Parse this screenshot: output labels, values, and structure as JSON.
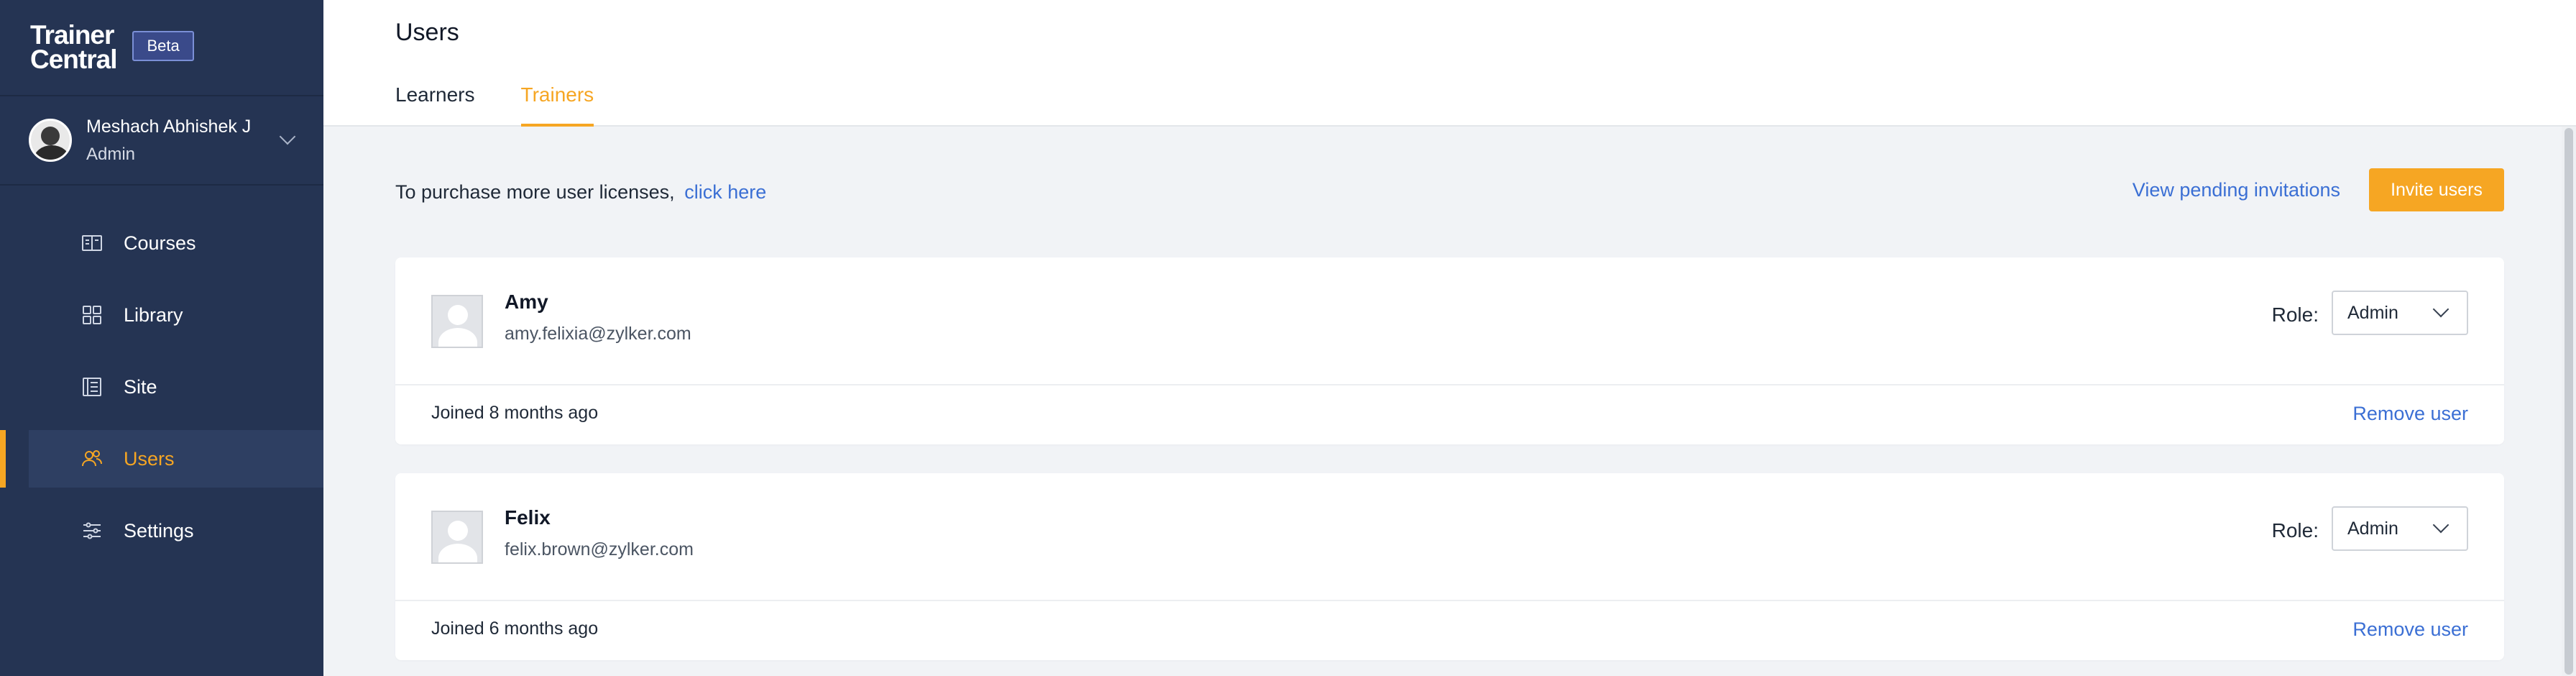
{
  "brand": {
    "logo_line1": "Trainer",
    "logo_line2": "Central",
    "badge": "Beta"
  },
  "profile": {
    "name": "Meshach Abhishek J",
    "role": "Admin"
  },
  "sidebar": {
    "items": [
      {
        "label": "Courses",
        "icon": "courses-icon"
      },
      {
        "label": "Library",
        "icon": "library-icon"
      },
      {
        "label": "Site",
        "icon": "site-icon"
      },
      {
        "label": "Users",
        "icon": "users-icon",
        "active": true
      },
      {
        "label": "Settings",
        "icon": "settings-icon"
      }
    ]
  },
  "header": {
    "title": "Users",
    "tabs": [
      {
        "label": "Learners"
      },
      {
        "label": "Trainers",
        "active": true
      }
    ]
  },
  "info": {
    "text": "To purchase more user licenses,",
    "link": "click here",
    "pending_link": "View pending invitations",
    "invite_button": "Invite users"
  },
  "users": [
    {
      "name": "Amy",
      "email": "amy.felixia@zylker.com",
      "role_label": "Role:",
      "role": "Admin",
      "joined": "Joined 8 months ago",
      "remove": "Remove user"
    },
    {
      "name": "Felix",
      "email": "felix.brown@zylker.com",
      "role_label": "Role:",
      "role": "Admin",
      "joined": "Joined 6 months ago",
      "remove": "Remove user"
    }
  ],
  "colors": {
    "sidebar_bg": "#253453",
    "accent": "#f6a623",
    "link": "#3b6fd4",
    "page_bg": "#f1f3f6"
  }
}
